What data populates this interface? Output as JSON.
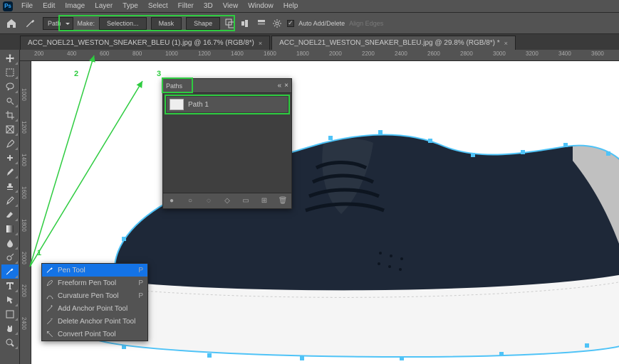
{
  "menu": {
    "items": [
      "File",
      "Edit",
      "Image",
      "Layer",
      "Type",
      "Select",
      "Filter",
      "3D",
      "View",
      "Window",
      "Help"
    ]
  },
  "options": {
    "mode": "Path",
    "make": "Make:",
    "selection": "Selection...",
    "mask": "Mask",
    "shape": "Shape",
    "auto": "Auto Add/Delete",
    "align": "Align Edges"
  },
  "tabs": [
    {
      "label": "ACC_NOEL21_WESTON_SNEAKER_BLEU (1).jpg @ 16.7% (RGB/8*)",
      "x": "×"
    },
    {
      "label": "ACC_NOEL21_WESTON_SNEAKER_BLEU.jpg @ 29.8% (RGB/8*) *",
      "x": "×"
    }
  ],
  "ruler_h": [
    "200",
    "400",
    "600",
    "800",
    "1000",
    "1200",
    "1400",
    "1600",
    "1800",
    "2000",
    "2200",
    "2400",
    "2600",
    "2800",
    "3000",
    "3200",
    "3400",
    "3600"
  ],
  "ruler_v": [
    "1000",
    "1200",
    "1400",
    "1600",
    "1800",
    "2000",
    "2200",
    "2400"
  ],
  "paths_panel": {
    "title": "Paths",
    "row": "Path 1"
  },
  "pen_flyout": {
    "items": [
      {
        "label": "Pen Tool",
        "sc": "P"
      },
      {
        "label": "Freeform Pen Tool",
        "sc": "P"
      },
      {
        "label": "Curvature Pen Tool",
        "sc": "P"
      },
      {
        "label": "Add Anchor Point Tool",
        "sc": ""
      },
      {
        "label": "Delete Anchor Point Tool",
        "sc": ""
      },
      {
        "label": "Convert Point Tool",
        "sc": ""
      }
    ]
  },
  "annots": {
    "n1": "1",
    "n2": "2",
    "n3": "3"
  }
}
